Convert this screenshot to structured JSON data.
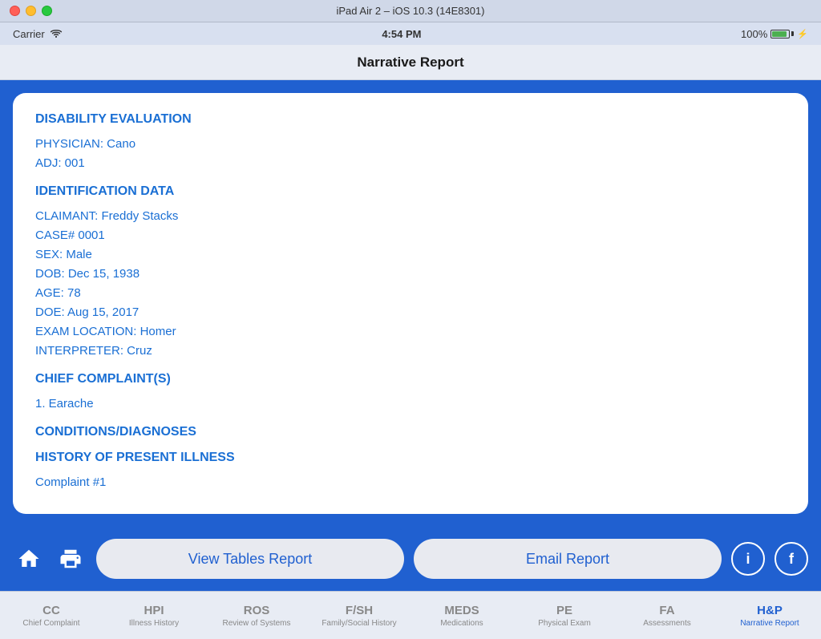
{
  "titleBar": {
    "title": "iPad Air 2 – iOS 10.3 (14E8301)"
  },
  "statusBar": {
    "carrier": "Carrier",
    "time": "4:54 PM",
    "battery": "100%"
  },
  "navBar": {
    "title": "Narrative Report"
  },
  "report": {
    "sectionTitle": "DISABILITY EVALUATION",
    "physician": "PHYSICIAN:  Cano",
    "adj": "ADJ:  001",
    "identTitle": "IDENTIFICATION DATA",
    "claimant": "CLAIMANT:  Freddy Stacks",
    "caseNum": "CASE#  0001",
    "sex": "SEX:  Male",
    "dob": "DOB:  Dec 15, 1938",
    "age": "AGE:  78",
    "doe": "DOE:  Aug 15, 2017",
    "examLocation": "EXAM LOCATION:  Homer",
    "interpreter": "INTERPRETER:  Cruz",
    "complaintTitle": "CHIEF COMPLAINT(S)",
    "complaint1": "1.  Earache",
    "conditionsTitle": "CONDITIONS/DIAGNOSES",
    "historyTitle": "HISTORY OF PRESENT ILLNESS",
    "historySubtitle": "Complaint #1"
  },
  "actions": {
    "viewTablesReport": "View Tables Report",
    "emailReport": "Email Report"
  },
  "tabs": [
    {
      "abbr": "CC",
      "label": "Chief Complaint",
      "active": false
    },
    {
      "abbr": "HPI",
      "label": "Illness History",
      "active": false
    },
    {
      "abbr": "ROS",
      "label": "Review of Systems",
      "active": false
    },
    {
      "abbr": "F/SH",
      "label": "Family/Social History",
      "active": false
    },
    {
      "abbr": "MEDS",
      "label": "Medications",
      "active": false
    },
    {
      "abbr": "PE",
      "label": "Physical Exam",
      "active": false
    },
    {
      "abbr": "FA",
      "label": "Assessments",
      "active": false
    },
    {
      "abbr": "H&P",
      "label": "Narrative Report",
      "active": true
    }
  ]
}
